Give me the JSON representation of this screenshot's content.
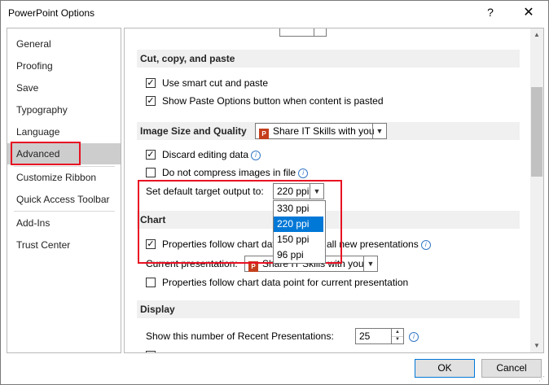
{
  "window": {
    "title": "PowerPoint Options",
    "help_glyph": "?",
    "close_glyph": "✕"
  },
  "nav": {
    "items": [
      {
        "label": "General"
      },
      {
        "label": "Proofing"
      },
      {
        "label": "Save"
      },
      {
        "label": "Typography"
      },
      {
        "label": "Language"
      },
      {
        "label": "Advanced",
        "selected": true
      },
      {
        "label": "Customize Ribbon"
      },
      {
        "label": "Quick Access Toolbar"
      },
      {
        "label": "Add-Ins"
      },
      {
        "label": "Trust Center"
      }
    ]
  },
  "sections": {
    "cut_copy_paste": {
      "heading": "Cut, copy, and paste",
      "use_smart_cut": {
        "label": "Use smart cut and paste",
        "checked": true
      },
      "show_paste_options": {
        "label": "Show Paste Options button when content is pasted",
        "checked": true
      }
    },
    "image_size_quality": {
      "heading": "Image Size and Quality",
      "presentation_selector": "Share IT Skills with you",
      "discard_editing": {
        "label": "Discard editing data",
        "checked": true
      },
      "do_not_compress": {
        "label": "Do not compress images in file",
        "checked": false
      },
      "default_output_label": "Set default target output to:",
      "default_output_value": "220 ppi",
      "output_options": [
        "330 ppi",
        "220 ppi",
        "150 ppi",
        "96 ppi"
      ],
      "highlighted_option": "220 ppi"
    },
    "chart": {
      "heading": "Chart",
      "follow_all_part1": "Properties follow chart dat",
      "follow_all_part2": "all new presentations",
      "follow_all_checked": true,
      "current_presentation_label": "Current presentation:",
      "current_presentation_value": "Share IT Skills with you",
      "follow_current": {
        "label": "Properties follow chart data point for current presentation",
        "checked": false
      }
    },
    "display": {
      "heading": "Display",
      "recent_label": "Show this number of Recent Presentations:",
      "recent_value": "25"
    }
  },
  "buttons": {
    "ok": "OK",
    "cancel": "Cancel"
  },
  "colors": {
    "accent": "#0078d7",
    "highlight_box": "#e81123",
    "nav_selected": "#cdcdcd"
  },
  "icons": [
    "help-icon",
    "close-icon",
    "info-icon",
    "powerpoint-file-icon",
    "dropdown-arrow-icon",
    "checkmark-icon",
    "scroll-up-icon",
    "scroll-down-icon",
    "spin-up-icon",
    "spin-down-icon"
  ]
}
